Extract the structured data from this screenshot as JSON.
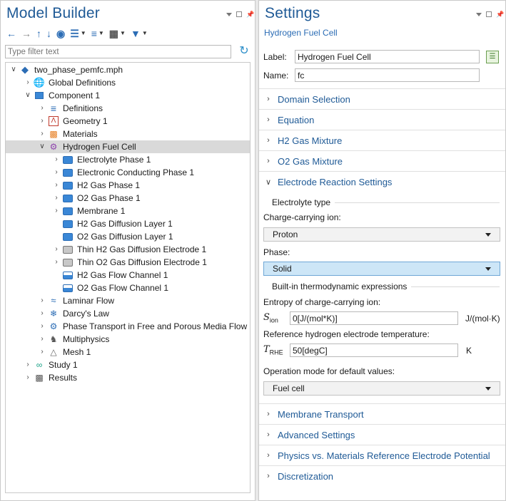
{
  "model_builder": {
    "title": "Model Builder",
    "filter_placeholder": "Type filter text",
    "tree": [
      {
        "label": "two_phase_pemfc.mph",
        "level": 0,
        "expander": "open",
        "icon": "mph-file-icon"
      },
      {
        "label": "Global Definitions",
        "level": 1,
        "expander": "closed",
        "icon": "globe-icon"
      },
      {
        "label": "Component 1",
        "level": 1,
        "expander": "open",
        "icon": "component-icon"
      },
      {
        "label": "Definitions",
        "level": 2,
        "expander": "closed",
        "icon": "definitions-icon"
      },
      {
        "label": "Geometry 1",
        "level": 2,
        "expander": "closed",
        "icon": "geometry-icon"
      },
      {
        "label": "Materials",
        "level": 2,
        "expander": "closed",
        "icon": "materials-icon"
      },
      {
        "label": "Hydrogen Fuel Cell",
        "level": 2,
        "expander": "open",
        "icon": "fuel-cell-icon",
        "selected": true
      },
      {
        "label": "Electrolyte Phase 1",
        "level": 3,
        "expander": "closed",
        "icon": "phase-d-icon"
      },
      {
        "label": "Electronic Conducting Phase 1",
        "level": 3,
        "expander": "closed",
        "icon": "phase-d-icon"
      },
      {
        "label": "H2 Gas Phase 1",
        "level": 3,
        "expander": "closed",
        "icon": "phase-d-icon"
      },
      {
        "label": "O2 Gas Phase 1",
        "level": 3,
        "expander": "closed",
        "icon": "phase-d-icon"
      },
      {
        "label": "Membrane 1",
        "level": 3,
        "expander": "closed",
        "icon": "membrane-icon"
      },
      {
        "label": "H2 Gas Diffusion Layer 1",
        "level": 3,
        "expander": "none",
        "icon": "diffusion-layer-icon"
      },
      {
        "label": "O2 Gas Diffusion Layer 1",
        "level": 3,
        "expander": "none",
        "icon": "diffusion-layer-icon"
      },
      {
        "label": "Thin H2 Gas Diffusion Electrode 1",
        "level": 3,
        "expander": "closed",
        "icon": "thin-electrode-icon"
      },
      {
        "label": "Thin O2 Gas Diffusion Electrode 1",
        "level": 3,
        "expander": "closed",
        "icon": "thin-electrode-icon"
      },
      {
        "label": "H2 Gas Flow Channel 1",
        "level": 3,
        "expander": "none",
        "icon": "flow-channel-icon"
      },
      {
        "label": "O2 Gas Flow Channel 1",
        "level": 3,
        "expander": "none",
        "icon": "flow-channel-icon"
      },
      {
        "label": "Laminar Flow",
        "level": 2,
        "expander": "closed",
        "icon": "laminar-flow-icon"
      },
      {
        "label": "Darcy's Law",
        "level": 2,
        "expander": "closed",
        "icon": "darcys-law-icon"
      },
      {
        "label": "Phase Transport in Free and Porous Media Flow",
        "level": 2,
        "expander": "closed",
        "icon": "phase-transport-icon"
      },
      {
        "label": "Multiphysics",
        "level": 2,
        "expander": "closed",
        "icon": "multiphysics-icon"
      },
      {
        "label": "Mesh 1",
        "level": 2,
        "expander": "closed",
        "icon": "mesh-icon"
      },
      {
        "label": "Study 1",
        "level": 1,
        "expander": "closed",
        "icon": "study-icon"
      },
      {
        "label": "Results",
        "level": 1,
        "expander": "closed",
        "icon": "results-icon"
      }
    ]
  },
  "settings": {
    "title": "Settings",
    "subtitle": "Hydrogen Fuel Cell",
    "label_caption": "Label:",
    "label_value": "Hydrogen Fuel Cell",
    "name_caption": "Name:",
    "name_value": "fc",
    "sections_top": [
      "Domain Selection",
      "Equation",
      "H2 Gas Mixture",
      "O2 Gas Mixture"
    ],
    "expanded_section": "Electrode Reaction Settings",
    "electrolyte_group": "Electrolyte type",
    "charge_ion_label": "Charge-carrying ion:",
    "charge_ion_value": "Proton",
    "phase_label": "Phase:",
    "phase_value": "Solid",
    "builtin_group": "Built-in thermodynamic expressions",
    "entropy_label": "Entropy of charge-carrying ion:",
    "entropy_symbol": "S",
    "entropy_sub": "ion",
    "entropy_value": "0[J/(mol*K)]",
    "entropy_unit": "J/(mol·K)",
    "temp_label": "Reference hydrogen electrode temperature:",
    "temp_symbol": "T",
    "temp_sub": "RHE",
    "temp_value": "50[degC]",
    "temp_unit": "K",
    "op_mode_label": "Operation mode for default values:",
    "op_mode_value": "Fuel cell",
    "sections_bottom": [
      "Membrane Transport",
      "Advanced Settings",
      "Physics vs. Materials Reference Electrode Potential",
      "Discretization"
    ]
  },
  "colors": {
    "title_blue": "#1f5a96",
    "accent_blue": "#2c6db5",
    "selection_gray": "#d9d9d9",
    "combo_highlight": "#cde6f7"
  }
}
